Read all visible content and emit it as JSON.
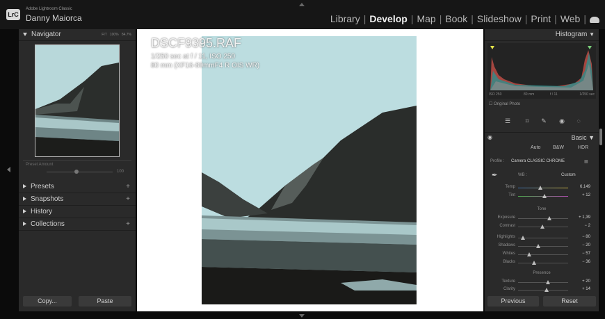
{
  "app": {
    "logo_text": "LrC",
    "app_name": "Adobe Lightroom Classic",
    "user_name": "Danny Maiorca",
    "modules": [
      "Library",
      "Develop",
      "Map",
      "Book",
      "Slideshow",
      "Print",
      "Web"
    ],
    "active_module": "Develop",
    "cloud_icon": "cloud-icon"
  },
  "left_panel": {
    "navigator": {
      "title": "Navigator",
      "zoom_fit": "FIT",
      "zoom_100": "100%",
      "zoom_custom": "84.7%"
    },
    "preset_amount": {
      "label": "Preset Amount",
      "max": "100"
    },
    "sections": [
      {
        "label": "Presets",
        "action": "+"
      },
      {
        "label": "Snapshots",
        "action": "+"
      },
      {
        "label": "History",
        "action": ""
      },
      {
        "label": "Collections",
        "action": "+"
      }
    ],
    "copy_label": "Copy...",
    "paste_label": "Paste"
  },
  "photo_info": {
    "filename": "DSCF9395.RAF",
    "exposure_line": "1/250 sec at f / 11, ISO 250",
    "lens_line": "80 mm (XF16-80mmF4 R OIS WR)"
  },
  "right_panel": {
    "histogram_title": "Histogram",
    "exif": {
      "iso": "ISO 250",
      "focal": "80 mm",
      "aperture": "f / 11",
      "shutter": "1/250 sec"
    },
    "original_photo_label": "Original Photo",
    "basic_title": "Basic",
    "treatment": [
      "Auto",
      "B&W",
      "HDR"
    ],
    "profile_label": "Profile :",
    "profile_value": "Camera CLASSIC CHROME",
    "wb_label": "WB :",
    "wb_value": "Custom",
    "temp": {
      "label": "Temp",
      "value": "6,149",
      "level": 0.45
    },
    "tint": {
      "label": "Tint",
      "value": "+ 12",
      "level": 0.53
    },
    "tone_label": "Tone",
    "exposure": {
      "label": "Exposure",
      "value": "+ 1,39",
      "level": 0.62
    },
    "contrast": {
      "label": "Contrast",
      "value": "− 2",
      "level": 0.49
    },
    "highlights": {
      "label": "Highlights",
      "value": "− 80",
      "level": 0.1
    },
    "shadows": {
      "label": "Shadows",
      "value": "− 20",
      "level": 0.4
    },
    "whites": {
      "label": "Whites",
      "value": "− 57",
      "level": 0.22
    },
    "blacks": {
      "label": "Blacks",
      "value": "− 36",
      "level": 0.32
    },
    "presence_label": "Presence",
    "texture": {
      "label": "Texture",
      "value": "+ 20",
      "level": 0.6
    },
    "clarity": {
      "label": "Clarity",
      "value": "+ 14",
      "level": 0.57
    },
    "previous_label": "Previous",
    "reset_label": "Reset"
  }
}
